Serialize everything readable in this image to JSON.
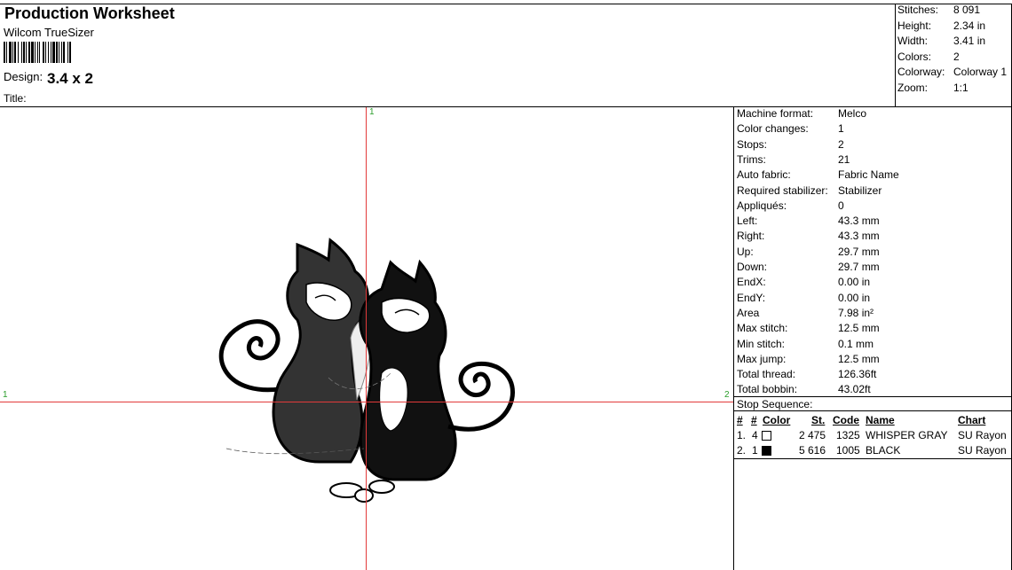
{
  "header": {
    "title": "Production Worksheet",
    "software": "Wilcom TrueSizer",
    "design_label": "Design:",
    "design_value": "3.4 x 2",
    "title_label": "Title:"
  },
  "summary": [
    {
      "label": "Stitches:",
      "value": "8 091"
    },
    {
      "label": "Height:",
      "value": "2.34 in"
    },
    {
      "label": "Width:",
      "value": "3.41 in"
    },
    {
      "label": "Colors:",
      "value": "2"
    },
    {
      "label": "Colorway:",
      "value": "Colorway 1"
    },
    {
      "label": "Zoom:",
      "value": "1:1"
    }
  ],
  "details": [
    {
      "label": "Machine format:",
      "value": "Melco"
    },
    {
      "label": "Color changes:",
      "value": "1"
    },
    {
      "label": "Stops:",
      "value": "2"
    },
    {
      "label": "Trims:",
      "value": "21"
    },
    {
      "label": "Auto fabric:",
      "value": "Fabric Name"
    },
    {
      "label": "Required stabilizer:",
      "value": "Stabilizer"
    },
    {
      "label": "Appliqués:",
      "value": "0"
    },
    {
      "label": "Left:",
      "value": "43.3 mm"
    },
    {
      "label": "Right:",
      "value": "43.3 mm"
    },
    {
      "label": "Up:",
      "value": "29.7 mm"
    },
    {
      "label": "Down:",
      "value": "29.7 mm"
    },
    {
      "label": "EndX:",
      "value": "0.00 in"
    },
    {
      "label": "EndY:",
      "value": "0.00 in"
    },
    {
      "label": "Area",
      "value": " 7.98 in²"
    },
    {
      "label": "Max stitch:",
      "value": "12.5 mm"
    },
    {
      "label": "Min stitch:",
      "value": "0.1 mm"
    },
    {
      "label": "Max jump:",
      "value": "12.5 mm"
    },
    {
      "label": "Total thread:",
      "value": "126.36ft"
    },
    {
      "label": "Total bobbin:",
      "value": "43.02ft"
    }
  ],
  "stop_sequence": {
    "title": "Stop Sequence:",
    "headers": {
      "stop": "#",
      "needle": "#",
      "color": "Color",
      "stitches": "St.",
      "code": "Code",
      "name": "Name",
      "chart": "Chart"
    },
    "rows": [
      {
        "stop": "1.",
        "needle": "4",
        "color": "#ffffff",
        "stitches": "2 475",
        "code": "1325",
        "name": "WHISPER GRAY",
        "chart": "SU Rayon"
      },
      {
        "stop": "2.",
        "needle": "1",
        "color": "#000000",
        "stitches": "5 616",
        "code": "1005",
        "name": "BLACK",
        "chart": "SU Rayon"
      }
    ]
  },
  "axis_labels": {
    "top": "1",
    "left": "1",
    "right": "2"
  },
  "colors": {
    "crosshair": "#e23a3a",
    "axis_label": "#2a9d2a"
  }
}
